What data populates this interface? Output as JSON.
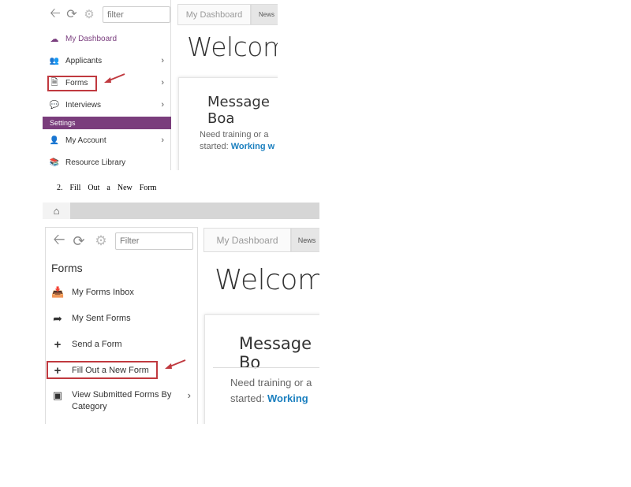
{
  "shot1": {
    "filter_placeholder": "filter",
    "tabs": {
      "dashboard": "My Dashboard",
      "news": "News"
    },
    "welcome": "Welcome,",
    "message_board": "Message Boa",
    "message_line1": "Need training or a",
    "message_line2_prefix": "started: ",
    "message_link": "Working w",
    "nav": {
      "dashboard": "My Dashboard",
      "applicants": "Applicants",
      "forms": "Forms",
      "interviews": "Interviews",
      "settings_header": "Settings",
      "account": "My Account",
      "resource_library": "Resource Library"
    },
    "colors": {
      "accent": "#7b3f7f",
      "settings_bar": "#7a3d7c",
      "annotation": "#c0393f"
    }
  },
  "caption": {
    "step": "2.",
    "words": [
      "Fill",
      "Out",
      "a",
      "New",
      "Form"
    ]
  },
  "shot2": {
    "filter_placeholder": "Filter",
    "tabs": {
      "dashboard": "My Dashboard",
      "news": "News"
    },
    "welcome": "Welcome,",
    "message_board": "Message Bo",
    "message_line1": "Need training or a",
    "message_line2_prefix": "started: ",
    "message_link": "Working",
    "panel_title": "Forms",
    "items": {
      "inbox": "My Forms Inbox",
      "sent": "My Sent Forms",
      "send": "Send a Form",
      "fill": "Fill Out a New Form",
      "submitted_line1": "View Submitted Forms By",
      "submitted_line2": "Category"
    }
  }
}
